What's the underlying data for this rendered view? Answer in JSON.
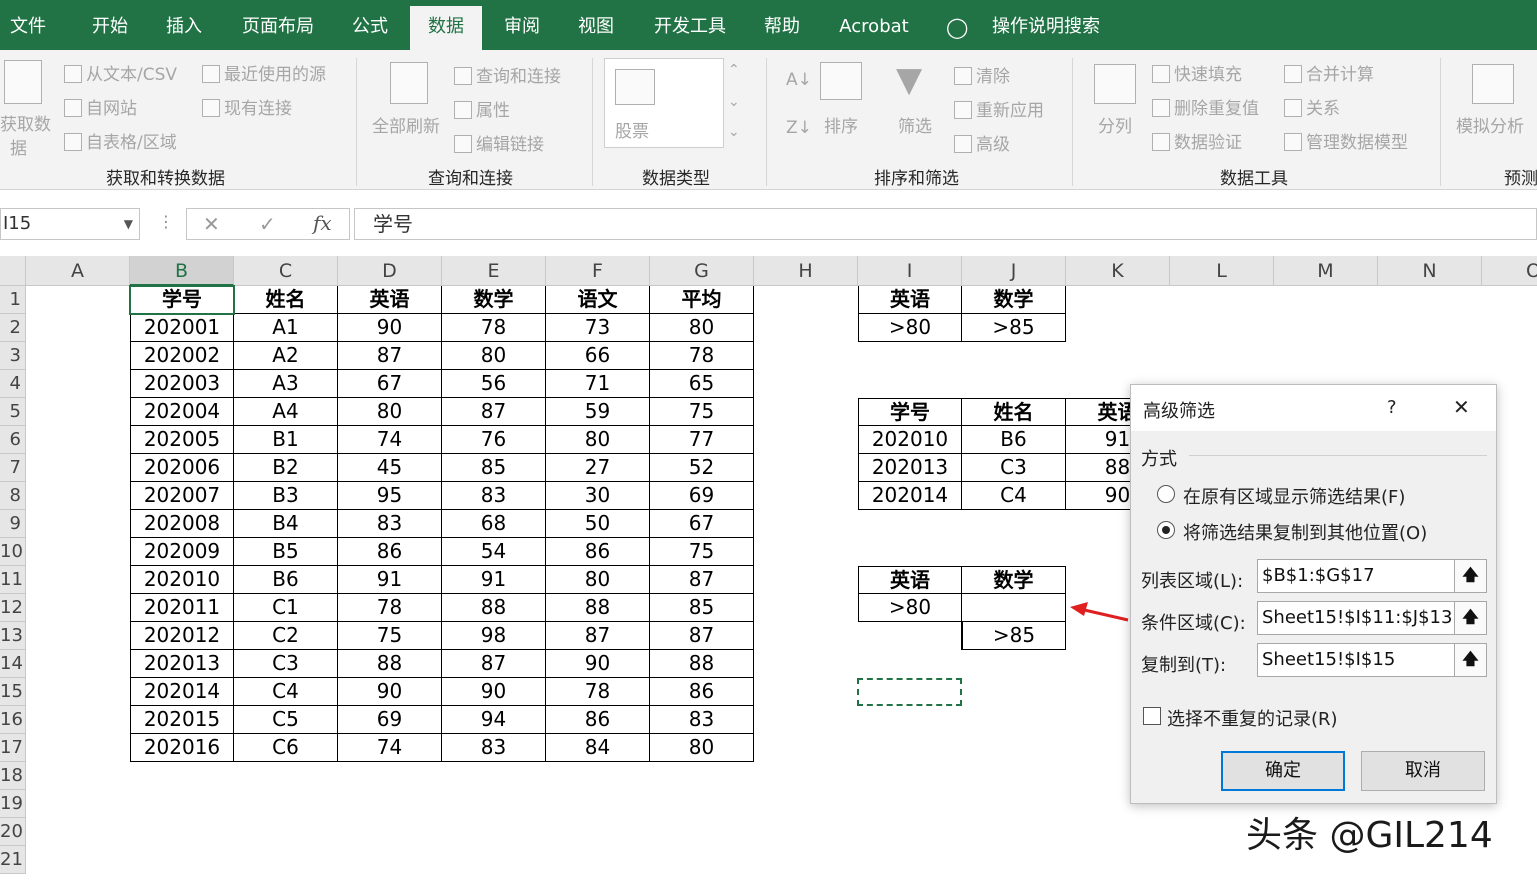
{
  "menu": {
    "tabs": [
      "文件",
      "开始",
      "插入",
      "页面布局",
      "公式",
      "数据",
      "审阅",
      "视图",
      "开发工具",
      "帮助",
      "Acrobat"
    ],
    "active": "数据",
    "search_label": "操作说明搜索"
  },
  "ribbon": {
    "get_data_line1": "获取数",
    "get_data_line2": "据",
    "from_text": "从文本/CSV",
    "recent_sources": "最近使用的源",
    "from_web": "自网站",
    "existing_connections": "现有连接",
    "from_table": "自表格/区域",
    "group_get": "获取和转换数据",
    "refresh_all": "全部刷新",
    "queries": "查询和连接",
    "properties": "属性",
    "edit_links": "编辑链接",
    "group_queries": "查询和连接",
    "stocks": "股票",
    "group_types": "数据类型",
    "sort": "排序",
    "filter": "筛选",
    "clear": "清除",
    "reapply": "重新应用",
    "advanced": "高级",
    "group_sort": "排序和筛选",
    "text_to_columns": "分列",
    "flash_fill": "快速填充",
    "remove_duplicates": "删除重复值",
    "data_validation": "数据验证",
    "consolidate": "合并计算",
    "relationships": "关系",
    "manage_model": "管理数据模型",
    "group_tools": "数据工具",
    "what_if": "模拟分析",
    "group_forecast": "预测"
  },
  "formula_bar": {
    "name_box": "I15",
    "cancel": "✕",
    "enter": "✓",
    "fx": "fx",
    "content": "学号"
  },
  "columns": [
    "A",
    "B",
    "C",
    "D",
    "E",
    "F",
    "G",
    "H",
    "I",
    "J",
    "K",
    "L",
    "M",
    "N",
    "O"
  ],
  "rows": [
    "1",
    "2",
    "3",
    "4",
    "5",
    "6",
    "7",
    "8",
    "9",
    "10",
    "11",
    "12",
    "13",
    "14",
    "15",
    "16",
    "17",
    "18",
    "19",
    "20",
    "21"
  ],
  "main_table": {
    "headers": [
      "学号",
      "姓名",
      "英语",
      "数学",
      "语文",
      "平均"
    ],
    "rows": [
      [
        "202001",
        "A1",
        "90",
        "78",
        "73",
        "80"
      ],
      [
        "202002",
        "A2",
        "87",
        "80",
        "66",
        "78"
      ],
      [
        "202003",
        "A3",
        "67",
        "56",
        "71",
        "65"
      ],
      [
        "202004",
        "A4",
        "80",
        "87",
        "59",
        "75"
      ],
      [
        "202005",
        "B1",
        "74",
        "76",
        "80",
        "77"
      ],
      [
        "202006",
        "B2",
        "45",
        "85",
        "27",
        "52"
      ],
      [
        "202007",
        "B3",
        "95",
        "83",
        "30",
        "69"
      ],
      [
        "202008",
        "B4",
        "83",
        "68",
        "50",
        "67"
      ],
      [
        "202009",
        "B5",
        "86",
        "54",
        "86",
        "75"
      ],
      [
        "202010",
        "B6",
        "91",
        "91",
        "80",
        "87"
      ],
      [
        "202011",
        "C1",
        "78",
        "88",
        "88",
        "85"
      ],
      [
        "202012",
        "C2",
        "75",
        "98",
        "87",
        "87"
      ],
      [
        "202013",
        "C3",
        "88",
        "87",
        "90",
        "88"
      ],
      [
        "202014",
        "C4",
        "90",
        "90",
        "78",
        "86"
      ],
      [
        "202015",
        "C5",
        "69",
        "94",
        "86",
        "83"
      ],
      [
        "202016",
        "C6",
        "74",
        "83",
        "84",
        "80"
      ]
    ]
  },
  "criteria1": {
    "headers": [
      "英语",
      "数学"
    ],
    "values": [
      ">80",
      ">85"
    ]
  },
  "result_table": {
    "headers": [
      "学号",
      "姓名",
      "英语"
    ],
    "rows": [
      [
        "202010",
        "B6",
        "91"
      ],
      [
        "202013",
        "C3",
        "88"
      ],
      [
        "202014",
        "C4",
        "90"
      ]
    ]
  },
  "criteria2": {
    "headers": [
      "英语",
      "数学"
    ],
    "row1": [
      ">80",
      ""
    ],
    "row2": [
      "",
      ">85"
    ]
  },
  "dialog": {
    "title": "高级筛选",
    "help": "?",
    "close": "✕",
    "mode_label": "方式",
    "option_inplace": "在原有区域显示筛选结果(F)",
    "option_copy": "将筛选结果复制到其他位置(O)",
    "list_range_label": "列表区域(L):",
    "list_range_value": "$B$1:$G$17",
    "criteria_range_label": "条件区域(C):",
    "criteria_range_value": "Sheet15!$I$11:$J$13",
    "copy_to_label": "复制到(T):",
    "copy_to_value": "Sheet15!$I$15",
    "unique_label": "选择不重复的记录(R)",
    "ok": "确定",
    "cancel": "取消"
  },
  "watermark": "头条 @GIL214"
}
